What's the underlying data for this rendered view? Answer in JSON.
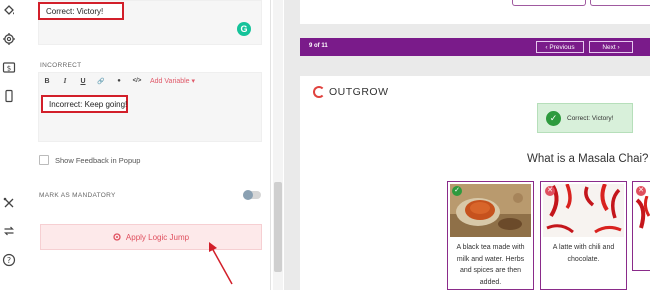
{
  "rail": {
    "icons": [
      "paint-bucket-icon",
      "gear-icon",
      "dollar-screen-icon",
      "mobile-icon",
      "tools-icon",
      "refresh-icon",
      "help-icon"
    ]
  },
  "editor": {
    "correct_text": "Correct: Victory!",
    "incorrect_label": "INCORRECT",
    "toolbar": {
      "bold": "B",
      "italic": "I",
      "underline": "U",
      "link": "🔗",
      "color": "●",
      "code": "</>",
      "add_variable": "Add Variable ▾"
    },
    "incorrect_text": "Incorrect: Keep going!",
    "show_feedback_label": "Show Feedback in Popup",
    "mandatory_label": "MARK AS MANDATORY",
    "apply_logic_jump": "Apply Logic Jump"
  },
  "preview": {
    "nav": {
      "count": "9 of 11",
      "previous": "‹  Previous",
      "next": "Next  ›"
    },
    "logo_text": "OUTGROW",
    "toast": {
      "text": "Correct: Victory!"
    },
    "question": "What is a Masala Chai?",
    "options": [
      {
        "text": "A black tea made with milk and water. Herbs and spices are then added.",
        "state": "correct"
      },
      {
        "text": "A latte with chili and chocolate.",
        "state": "incorrect"
      }
    ]
  },
  "colors": {
    "accent_red": "#d21f2a",
    "nav_purple": "#7a1b8a",
    "success_green": "#2e9a3e"
  }
}
